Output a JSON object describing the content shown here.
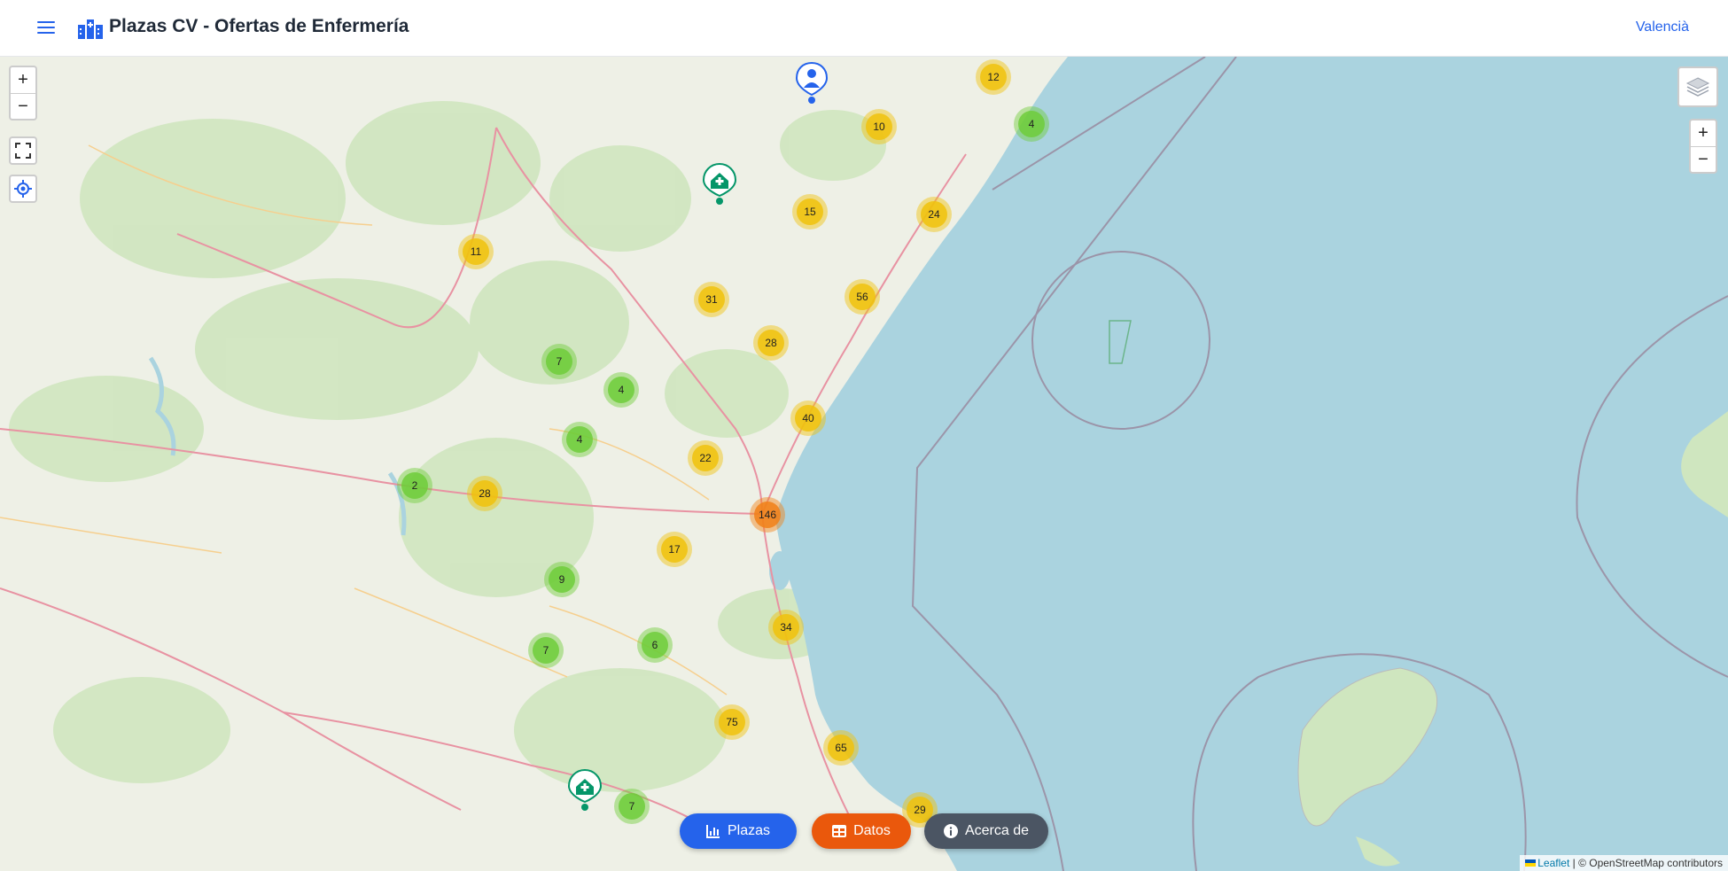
{
  "header": {
    "title": "Plazas CV - Ofertas de Enfermería",
    "language_link": "Valencià"
  },
  "map_controls": {
    "zoom_in": "+",
    "zoom_out": "−",
    "layers_zoom_in": "+",
    "layers_zoom_out": "−"
  },
  "clusters": [
    {
      "count": "12",
      "level": "medium"
    },
    {
      "count": "4",
      "level": "small"
    },
    {
      "count": "10",
      "level": "medium"
    },
    {
      "count": "15",
      "level": "medium"
    },
    {
      "count": "24",
      "level": "medium"
    },
    {
      "count": "11",
      "level": "medium"
    },
    {
      "count": "31",
      "level": "medium"
    },
    {
      "count": "56",
      "level": "medium"
    },
    {
      "count": "28",
      "level": "medium"
    },
    {
      "count": "7",
      "level": "small"
    },
    {
      "count": "4",
      "level": "small"
    },
    {
      "count": "40",
      "level": "medium"
    },
    {
      "count": "4",
      "level": "small"
    },
    {
      "count": "22",
      "level": "medium"
    },
    {
      "count": "2",
      "level": "small"
    },
    {
      "count": "28",
      "level": "medium"
    },
    {
      "count": "146",
      "level": "large"
    },
    {
      "count": "17",
      "level": "medium"
    },
    {
      "count": "9",
      "level": "small"
    },
    {
      "count": "34",
      "level": "medium"
    },
    {
      "count": "7",
      "level": "small"
    },
    {
      "count": "6",
      "level": "small"
    },
    {
      "count": "75",
      "level": "medium"
    },
    {
      "count": "65",
      "level": "medium"
    },
    {
      "count": "7",
      "level": "small"
    },
    {
      "count": "29",
      "level": "medium"
    }
  ],
  "colors": {
    "small": "#6ecc39",
    "medium": "#f0c20c",
    "large": "#f18017",
    "primary": "#2563eb",
    "datos": "#ea580c",
    "about": "#4b5563",
    "sea": "#aad3df",
    "hospital_pin": "#059669"
  },
  "bottom_buttons": {
    "plazas": "Plazas",
    "datos": "Datos",
    "acerca": "Acerca de"
  },
  "attribution": {
    "leaflet": "Leaflet",
    "osm": "| © OpenStreetMap contributors"
  }
}
